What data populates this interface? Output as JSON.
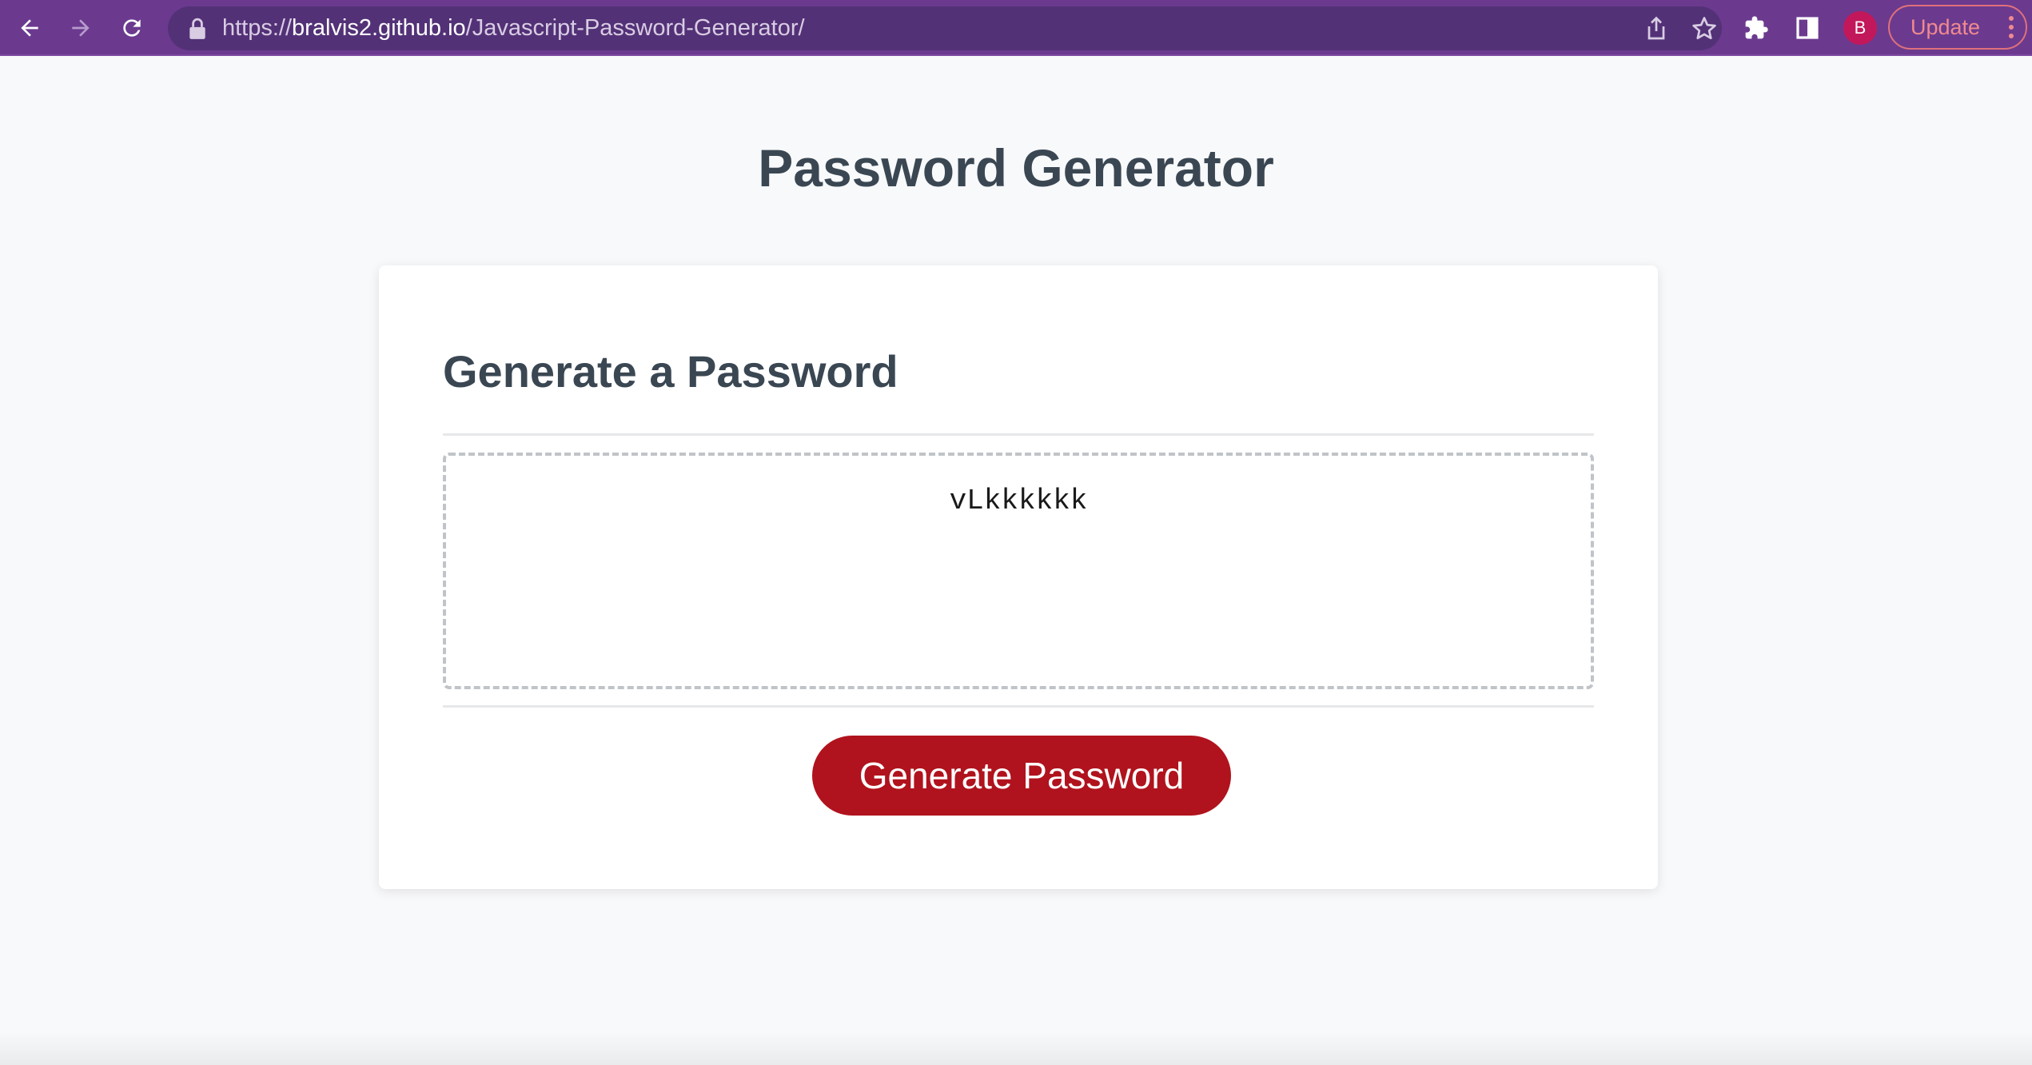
{
  "browser": {
    "url_scheme": "https://",
    "url_host": "bralvis2.github.io",
    "url_path": "/Javascript-Password-Generator/",
    "profile_initial": "B",
    "update_label": "Update",
    "toolbar_color": "#6b3a8f",
    "omnibox_color": "#533177",
    "icons": [
      "back-icon",
      "forward-icon",
      "reload-icon",
      "lock-icon",
      "share-icon",
      "star-icon",
      "extensions-icon",
      "side-panel-icon",
      "kebab-menu-icon"
    ]
  },
  "page": {
    "title": "Password Generator",
    "card": {
      "header": "Generate a Password",
      "password_value": "vLkkkkkk",
      "generate_button_label": "Generate Password"
    },
    "colors": {
      "heading": "#3a4753",
      "button": "#b0131d",
      "background": "#f8f9fb"
    }
  }
}
